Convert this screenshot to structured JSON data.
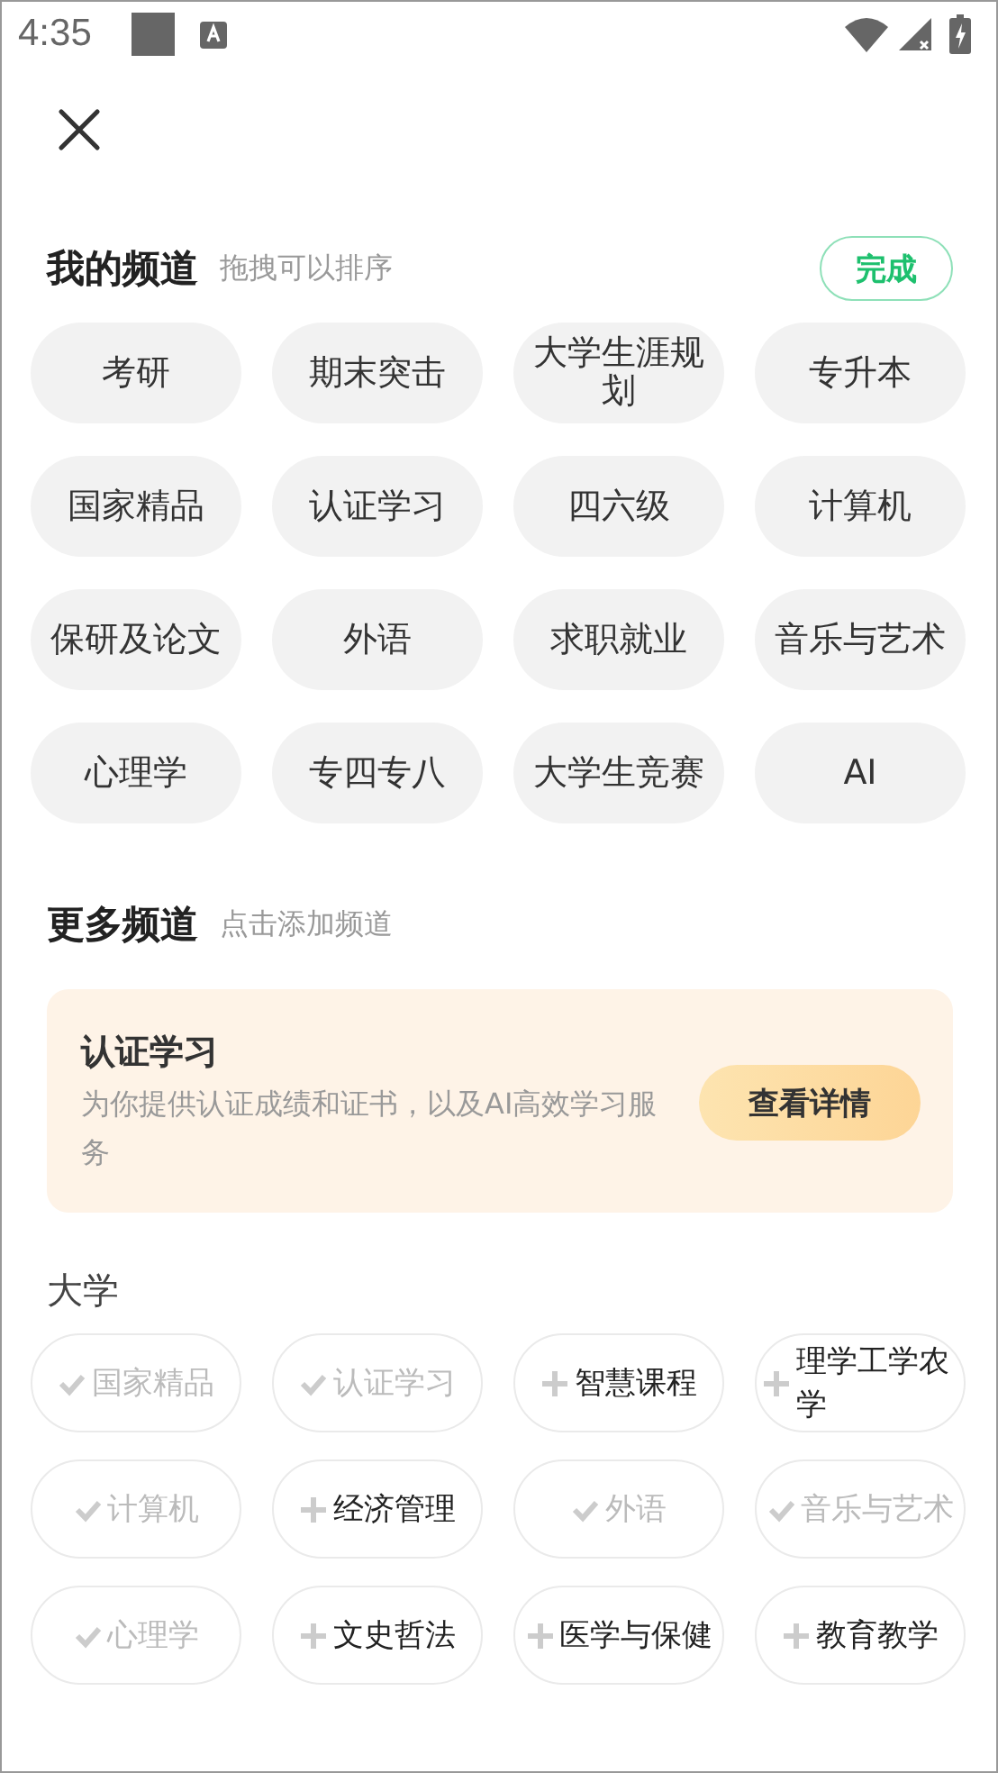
{
  "status_bar": {
    "time": "4:35"
  },
  "my_channels": {
    "title": "我的频道",
    "hint": "拖拽可以排序",
    "done_button": "完成",
    "items": [
      "考研",
      "期末突击",
      "大学生涯规划",
      "专升本",
      "国家精品",
      "认证学习",
      "四六级",
      "计算机",
      "保研及论文",
      "外语",
      "求职就业",
      "音乐与艺术",
      "心理学",
      "专四专八",
      "大学生竞赛",
      "AI"
    ]
  },
  "more_channels": {
    "title": "更多频道",
    "hint": "点击添加频道",
    "promo": {
      "title": "认证学习",
      "description": "为你提供认证成绩和证书，以及AI高效学习服务",
      "button": "查看详情"
    },
    "groups": [
      {
        "title": "大学",
        "items": [
          {
            "label": "国家精品",
            "added": true
          },
          {
            "label": "认证学习",
            "added": true
          },
          {
            "label": "智慧课程",
            "added": false
          },
          {
            "label": "理学工学农学",
            "added": false
          },
          {
            "label": "计算机",
            "added": true
          },
          {
            "label": "经济管理",
            "added": false
          },
          {
            "label": "外语",
            "added": true
          },
          {
            "label": "音乐与艺术",
            "added": true
          },
          {
            "label": "心理学",
            "added": true
          },
          {
            "label": "文史哲法",
            "added": false
          },
          {
            "label": "医学与保健",
            "added": false
          },
          {
            "label": "教育教学",
            "added": false
          }
        ]
      }
    ]
  }
}
